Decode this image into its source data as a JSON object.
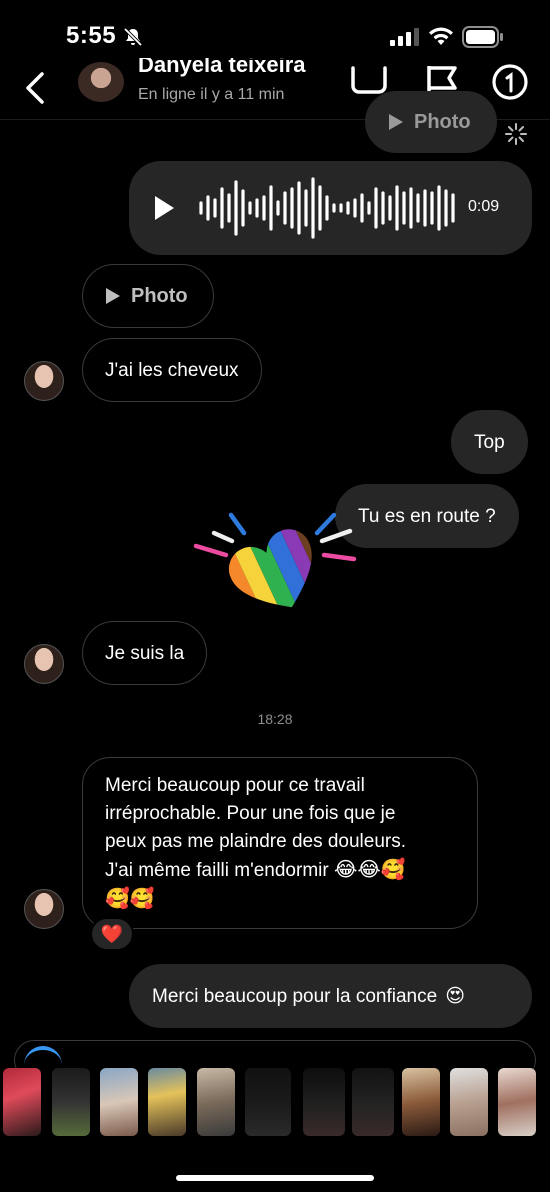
{
  "status_bar": {
    "time": "5:55"
  },
  "header": {
    "contact_name": "Danyela teixeira",
    "presence": "En ligne il y a 11 min",
    "icons": [
      "back-icon",
      "video-call-icon",
      "flag-icon",
      "info-icon"
    ]
  },
  "messages": {
    "top_photo_label": "Photo",
    "voice": {
      "duration": "0:09"
    },
    "photo_label": "Photo",
    "msg_cheveux": "J'ai les cheveux",
    "msg_top": "Top",
    "msg_en_route": "Tu es en route ?",
    "msg_je_suis_la": "Je suis la",
    "timestamp": "18:28",
    "long_line1": "Merci beaucoup pour ce travail",
    "long_line2": "irréprochable. Pour une fois que je",
    "long_line3": "peux pas me plaindre des douleurs.",
    "long_line4": "J'ai même failli m'endormir",
    "long_emojis_line4": "😂😂🥰",
    "long_emojis_line5": "🥰🥰",
    "reaction": "❤️",
    "msg_confiance": "Merci beaucoup pour la confiance",
    "msg_confiance_emoji": "😍"
  },
  "colors": {
    "background": "#000000",
    "outgoing_bubble": "#262626",
    "incoming_border": "#3a3a3c",
    "secondary_text": "#a8a8a8",
    "accent_blue": "#3797f0"
  }
}
